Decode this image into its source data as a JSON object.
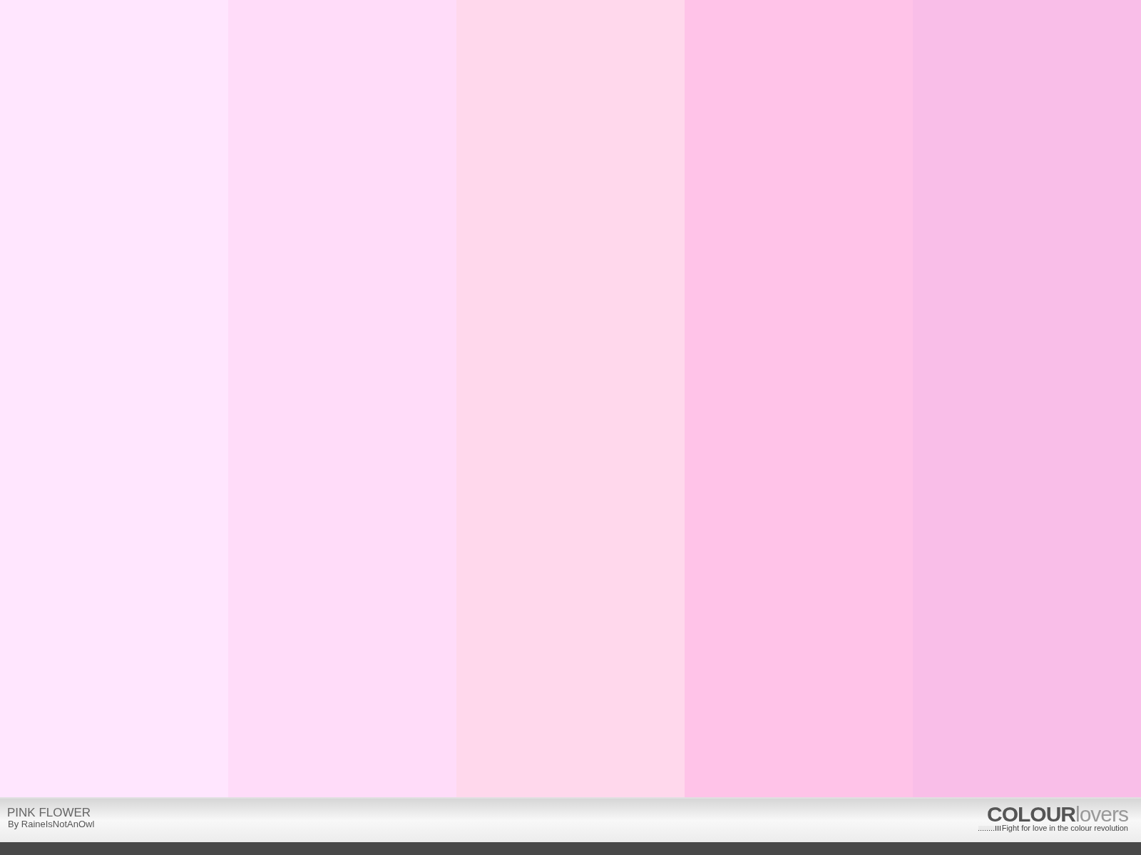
{
  "swatches": [
    {
      "color": "#ffe6fe"
    },
    {
      "color": "#ffdcf9"
    },
    {
      "color": "#ffd8ec"
    },
    {
      "color": "#ffc3e8"
    },
    {
      "color": "#f9bee8"
    }
  ],
  "footer": {
    "title": "PINK FLOWER",
    "author": "By RaineIsNotAnOwl",
    "logo": "**COLOUR**lovers",
    "tagline": "Fight for love in the colour revolution"
  }
}
